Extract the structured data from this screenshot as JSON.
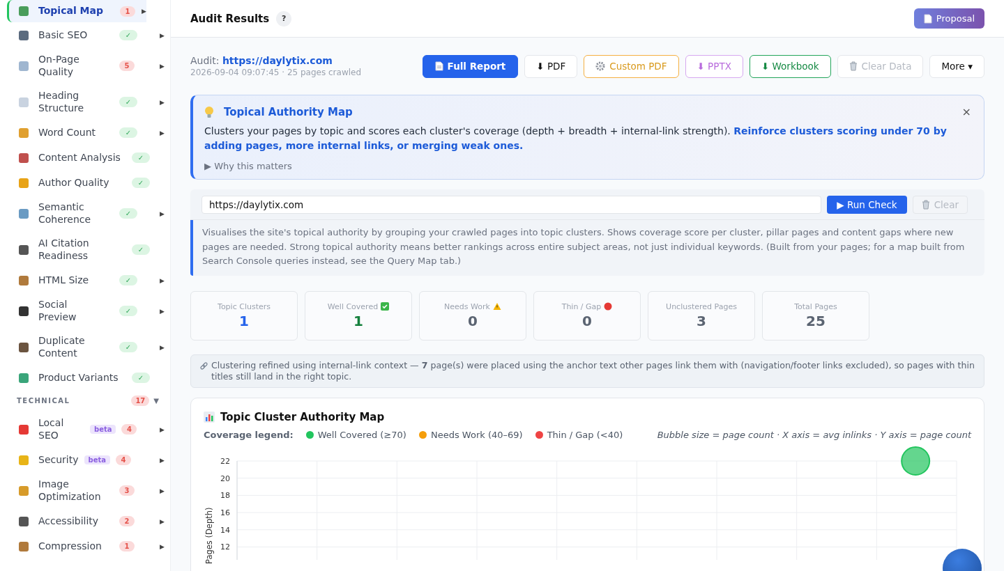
{
  "sidebar": {
    "items": [
      {
        "label": "Topical Map",
        "selected": true,
        "badge": {
          "kind": "count",
          "text": "1"
        },
        "arrow": "▶"
      },
      {
        "label": "Basic SEO",
        "selected": false,
        "badge": {
          "kind": "check",
          "text": "✓"
        },
        "arrow": "▶"
      },
      {
        "label": "On-Page Quality",
        "selected": false,
        "badge": {
          "kind": "count",
          "text": "5"
        },
        "arrow": "▶"
      },
      {
        "label": "Heading Structure",
        "selected": false,
        "badge": {
          "kind": "check",
          "text": "✓"
        },
        "arrow": "▶"
      },
      {
        "label": "Word Count",
        "selected": false,
        "badge": {
          "kind": "check",
          "text": "✓"
        },
        "arrow": "▶"
      },
      {
        "label": "Content Analysis",
        "selected": false,
        "badge": {
          "kind": "check",
          "text": "✓"
        }
      },
      {
        "label": "Author Quality",
        "selected": false,
        "badge": {
          "kind": "check",
          "text": "✓"
        }
      },
      {
        "label": "Semantic Coherence",
        "selected": false,
        "badge": {
          "kind": "check",
          "text": "✓"
        },
        "arrow": "▶"
      },
      {
        "label": "AI Citation Readiness",
        "selected": false,
        "badge": {
          "kind": "check",
          "text": "✓"
        }
      },
      {
        "label": "HTML Size",
        "selected": false,
        "badge": {
          "kind": "check",
          "text": "✓"
        },
        "arrow": "▶"
      },
      {
        "label": "Social Preview",
        "selected": false,
        "badge": {
          "kind": "check",
          "text": "✓"
        },
        "arrow": "▶"
      },
      {
        "label": "Duplicate Content",
        "selected": false,
        "badge": {
          "kind": "check",
          "text": "✓"
        },
        "arrow": "▶"
      },
      {
        "label": "Product Variants",
        "selected": false,
        "badge": {
          "kind": "check",
          "text": "✓"
        }
      }
    ],
    "section": {
      "title": "TECHNICAL",
      "count": "17",
      "caret": "▼",
      "items": [
        {
          "label": "Local SEO",
          "selected": false,
          "beta": "beta",
          "badge": {
            "kind": "count",
            "text": "4"
          },
          "arrow": "▶"
        },
        {
          "label": "Security",
          "selected": false,
          "beta": "beta",
          "badge": {
            "kind": "count",
            "text": "4"
          },
          "arrow": "▶"
        },
        {
          "label": "Image Optimization",
          "selected": false,
          "badge": {
            "kind": "count",
            "text": "3"
          },
          "arrow": "▶"
        },
        {
          "label": "Accessibility",
          "selected": false,
          "badge": {
            "kind": "count",
            "text": "2"
          },
          "arrow": "▶"
        },
        {
          "label": "Compression",
          "selected": false,
          "badge": {
            "kind": "count",
            "text": "1"
          },
          "arrow": "▶"
        }
      ]
    }
  },
  "header": {
    "title": "Audit Results",
    "help": "?",
    "proposal": "Proposal"
  },
  "audit": {
    "label": "Audit:",
    "url": "https://daylytix.com",
    "meta": "2026-09-04 09:07:45 · 25 pages crawled"
  },
  "toolbar": [
    {
      "kind": "primary",
      "label": "Full Report"
    },
    {
      "kind": "plain",
      "label": "⬇ PDF"
    },
    {
      "kind": "warning",
      "label": "Custom PDF"
    },
    {
      "kind": "purple",
      "label": "⬇ PPTX"
    },
    {
      "kind": "success",
      "label": "⬇ Workbook"
    },
    {
      "kind": "disabled",
      "label": "Clear Data"
    },
    {
      "kind": "plain",
      "label": "More ▾"
    }
  ],
  "info": {
    "title": "Topical Authority Map",
    "close": "×",
    "text": "Clusters your pages by topic and scores each cluster's coverage (depth + breadth + internal-link strength). **Reinforce clusters scoring under 70 by adding pages, more internal links, or merging weak ones.**",
    "why": "▶ Why this matters"
  },
  "check": {
    "value": "https://daylytix.com",
    "run": "▶ Run Check",
    "clear": "Clear",
    "description": "Visualises the site's topical authority by grouping your crawled pages into topic clusters. Shows coverage score per cluster, pillar pages and content gaps where new pages are needed. Strong topical authority means better rankings across entire subject areas, not just individual keywords. (Built from your pages; for a map built from Search Console queries instead, see the Query Map tab.)"
  },
  "stats": [
    {
      "label": "Topic Clusters",
      "value": "1",
      "kind": "info"
    },
    {
      "label": "Well Covered",
      "value": "1",
      "kind": "good"
    },
    {
      "label": "Needs Work",
      "value": "0",
      "kind": "warn"
    },
    {
      "label": "Thin / Gap",
      "value": "0",
      "kind": "bad"
    },
    {
      "label": "Unclustered Pages",
      "value": "3",
      "kind": "neutral"
    },
    {
      "label": "Total Pages",
      "value": "25",
      "kind": "neutral"
    }
  ],
  "note": "Clustering refined using internal-link context — **7** page(s) were placed using the anchor text other pages link them with (navigation/footer links excluded), so pages with thin titles still land in the right topic.",
  "chart_card": {
    "title": "Topic Cluster Authority Map",
    "legend_label": "Coverage legend:",
    "legend": [
      {
        "label": "Well Covered (≥70)",
        "color": "#22c55e"
      },
      {
        "label": "Needs Work (40–69)",
        "color": "#f59e0b"
      },
      {
        "label": "Thin / Gap (<40)",
        "color": "#ef4444"
      }
    ],
    "hint": "Bubble size = page count · X axis = avg inlinks · Y axis = page count",
    "chart_data": {
      "type": "scatter",
      "ylabel": "Pages (Depth)",
      "yticks": [
        12,
        14,
        16,
        18,
        20,
        22
      ],
      "ylim": [
        10.5,
        22
      ],
      "grid": true,
      "categories": [
        null
      ],
      "series": [
        {
          "color": "#22c55e",
          "values": [
            22
          ]
        }
      ]
    }
  }
}
